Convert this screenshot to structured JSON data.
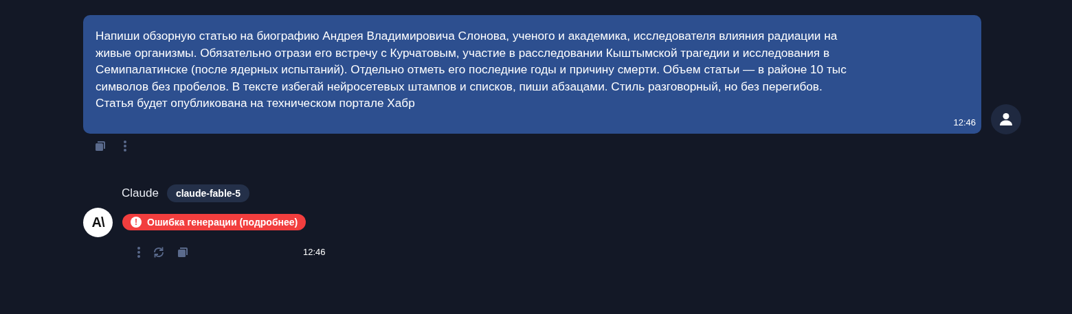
{
  "user_message": {
    "text": "Напиши обзорную статью на биографию Андрея Владимировича Слонова, ученого и академика, исследователя влияния радиации на\nживые организмы. Обязательно отрази его встречу с Курчатовым, участие в расследовании Кыштымской трагедии и исследования в\nСемипалатинске (после ядерных испытаний). Отдельно отметь его последние годы и причину смерти. Объем статьи — в районе 10 тыс\nсимволов без пробелов. В тексте избегай нейросетевых штампов и списков, пиши абзацами. Стиль разговорный, но без перегибов.\nСтатья будет опубликована на техническом портале Хабр",
    "time": "12:46"
  },
  "assistant_message": {
    "name": "Claude",
    "model": "claude-fable-5",
    "avatar": "A\\",
    "error": {
      "icon": "!",
      "text": "Ошибка генерации (подробнее)"
    },
    "time": "12:46"
  }
}
